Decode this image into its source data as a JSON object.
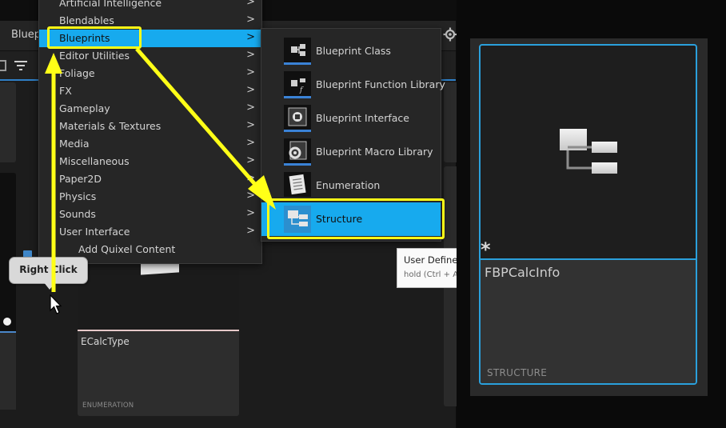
{
  "editor": {
    "tab_label": "Bluepri"
  },
  "context_menu": {
    "items": [
      {
        "label": "Artificial Intelligence",
        "has_submenu": true
      },
      {
        "label": "Blendables",
        "has_submenu": true
      },
      {
        "label": "Blueprints",
        "has_submenu": true,
        "highlighted": true
      },
      {
        "label": "Editor Utilities",
        "has_submenu": true
      },
      {
        "label": "Foliage",
        "has_submenu": true
      },
      {
        "label": "FX",
        "has_submenu": true
      },
      {
        "label": "Gameplay",
        "has_submenu": true
      },
      {
        "label": "Materials & Textures",
        "has_submenu": true
      },
      {
        "label": "Media",
        "has_submenu": true
      },
      {
        "label": "Miscellaneous",
        "has_submenu": true
      },
      {
        "label": "Paper2D",
        "has_submenu": true
      },
      {
        "label": "Physics",
        "has_submenu": true
      },
      {
        "label": "Sounds",
        "has_submenu": true
      },
      {
        "label": "User Interface",
        "has_submenu": true
      },
      {
        "label": "Add Quixel Content",
        "has_submenu": false,
        "icon": "quixel-icon"
      }
    ],
    "chevron": ">"
  },
  "sub_menu": {
    "items": [
      {
        "label": "Blueprint Class",
        "icon": "blueprint-class-icon"
      },
      {
        "label": "Blueprint Function Library",
        "icon": "function-library-icon"
      },
      {
        "label": "Blueprint Interface",
        "icon": "blueprint-interface-icon"
      },
      {
        "label": "Blueprint Macro Library",
        "icon": "macro-library-icon"
      },
      {
        "label": "Enumeration",
        "icon": "enumeration-icon"
      },
      {
        "label": "Structure",
        "icon": "structure-icon",
        "highlighted": true
      }
    ]
  },
  "tooltip": {
    "title": "User Defined",
    "hint": "hold (Ctrl + A"
  },
  "annotation": {
    "balloon_text": "Right Click",
    "highlight_color": "#ffff17"
  },
  "enum_asset": {
    "name": "ECalcType",
    "type": "ENUMERATION"
  },
  "preview_asset": {
    "name": "FBPCalcInfo",
    "type": "STRUCTURE",
    "new_marker": "*"
  },
  "colors": {
    "accent_blue": "#17aaee",
    "selection_border": "#2aa0dc",
    "menu_bg": "#262626"
  }
}
